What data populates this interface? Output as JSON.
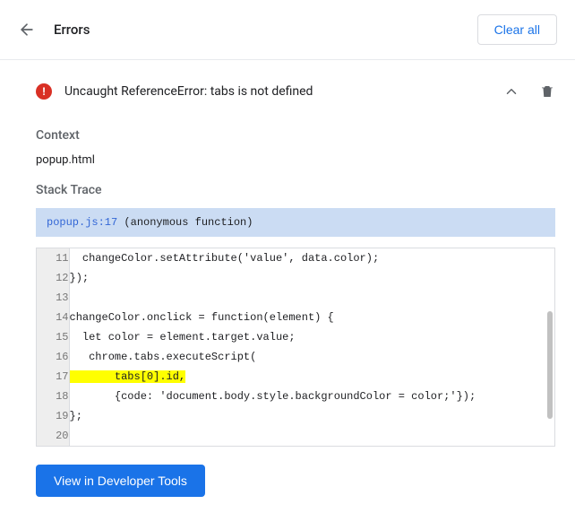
{
  "header": {
    "title": "Errors",
    "clear_label": "Clear all"
  },
  "error": {
    "message": "Uncaught ReferenceError: tabs is not defined"
  },
  "context": {
    "label": "Context",
    "value": "popup.html"
  },
  "stack": {
    "label": "Stack Trace",
    "file": "popup.js:17",
    "fn": "(anonymous function)"
  },
  "code": {
    "lines": [
      {
        "n": "11",
        "text": "  changeColor.setAttribute('value', data.color);",
        "hl": false
      },
      {
        "n": "12",
        "text": "});",
        "hl": false
      },
      {
        "n": "13",
        "text": "",
        "hl": false
      },
      {
        "n": "14",
        "text": "changeColor.onclick = function(element) {",
        "hl": false
      },
      {
        "n": "15",
        "text": "  let color = element.target.value;",
        "hl": false
      },
      {
        "n": "16",
        "text": "   chrome.tabs.executeScript(",
        "hl": false
      },
      {
        "n": "17",
        "text": "       tabs[0].id,",
        "hl": true
      },
      {
        "n": "18",
        "text": "       {code: 'document.body.style.backgroundColor = color;'});",
        "hl": false
      },
      {
        "n": "19",
        "text": "};",
        "hl": false
      },
      {
        "n": "20",
        "text": "",
        "hl": false
      }
    ]
  },
  "footer": {
    "dev_tools_label": "View in Developer Tools"
  }
}
